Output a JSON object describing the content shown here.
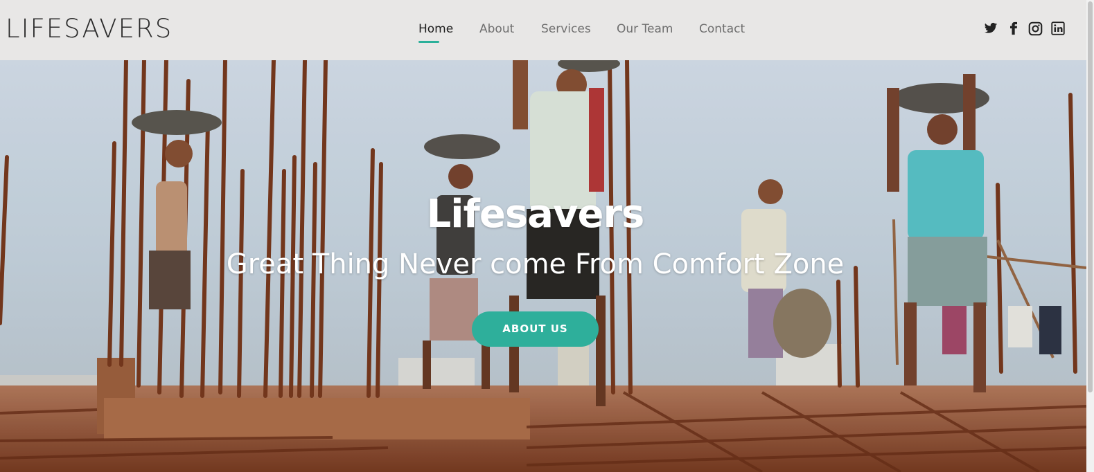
{
  "header": {
    "logo": "LIFESAVERS",
    "nav": [
      {
        "label": "Home",
        "active": true
      },
      {
        "label": "About",
        "active": false
      },
      {
        "label": "Services",
        "active": false
      },
      {
        "label": "Our Team",
        "active": false
      },
      {
        "label": "Contact",
        "active": false
      }
    ],
    "social_icons": [
      "twitter-icon",
      "facebook-icon",
      "instagram-icon",
      "linkedin-icon"
    ]
  },
  "hero": {
    "title": "Lifesavers",
    "subtitle": "Great Thing Never come From Comfort Zone",
    "button_label": "ABOUT US",
    "image_description_icon": "construction-workers-photo"
  },
  "colors": {
    "accent": "#2eaf9b",
    "header_bg": "#e8e7e6",
    "nav_text": "#6f6f6f",
    "nav_active": "#1e1e1e"
  }
}
